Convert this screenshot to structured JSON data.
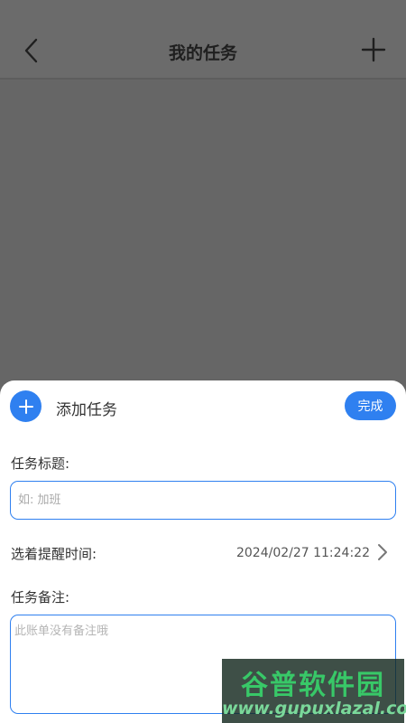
{
  "header": {
    "title": "我的任务"
  },
  "sheet": {
    "title": "添加任务",
    "done_label": "完成",
    "task_title_label": "任务标题:",
    "task_title_placeholder": "如: 加班",
    "reminder_label": "选着提醒时间:",
    "reminder_value": "2024/02/27 11:24:22",
    "note_label": "任务备注:",
    "note_placeholder": "此账单没有备注哦"
  },
  "watermark": {
    "main": "谷普软件园",
    "sub": "www.gupuxlazal.com"
  },
  "colors": {
    "accent": "#2f80f0",
    "overlay": "#666666"
  },
  "icons": {
    "back": "chevron-left-icon",
    "add": "plus-icon",
    "sheet_add": "plus-circle-icon",
    "reminder_arrow": "chevron-right-icon"
  }
}
